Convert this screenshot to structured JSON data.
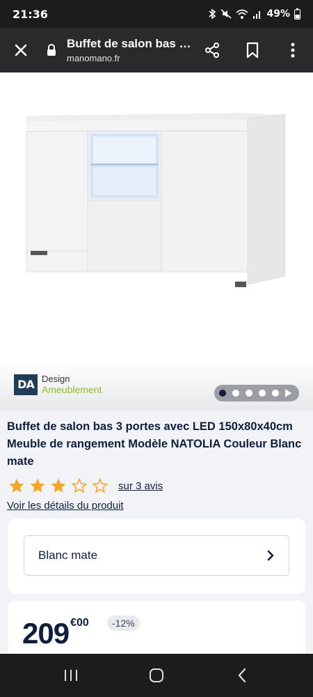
{
  "status_bar": {
    "time": "21:36",
    "battery": "49%",
    "icons": [
      "bluetooth-icon",
      "mute-icon",
      "wifi-icon",
      "signal-icon",
      "battery-icon"
    ]
  },
  "browser": {
    "page_title": "Buffet de salon bas 3 portes avec LED 150x80x40cm Meuble de rangement Modèle NATOLIA Couleur Blanc mate",
    "domain": "manomano.fr",
    "icons": [
      "close-icon",
      "lock-icon",
      "share-icon",
      "bookmark-icon",
      "more-vert-icon"
    ]
  },
  "gallery": {
    "brand": {
      "initials": "DA",
      "line1": "Design",
      "line2": "Ameublement"
    },
    "dots_total": 5,
    "dot_active": 1
  },
  "product": {
    "title": "Buffet de salon bas 3 portes avec LED 150x80x40cm Meuble de rangement Modèle NATOLIA Couleur Blanc mate",
    "rating": 3,
    "rating_max": 5,
    "reviews_label": "sur 3 avis",
    "details_link": "Voir les détails du produit"
  },
  "variant": {
    "selected": "Blanc mate"
  },
  "price": {
    "integer": "209",
    "decimal": "€00",
    "discount": "-12%"
  },
  "colors": {
    "navy": "#0f1e3c",
    "star": "#f5a623",
    "brand_green": "#8dbb2f"
  },
  "nav": {
    "icons": [
      "recent-apps-icon",
      "home-icon",
      "back-icon"
    ]
  }
}
